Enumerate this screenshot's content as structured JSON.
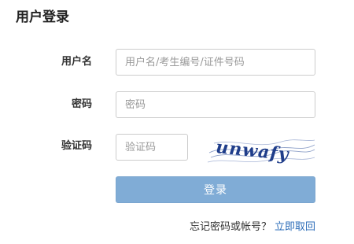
{
  "page": {
    "title": "用户登录"
  },
  "form": {
    "username": {
      "label": "用户名",
      "placeholder": "用户名/考生编号/证件号码",
      "value": ""
    },
    "password": {
      "label": "密码",
      "placeholder": "密码",
      "value": ""
    },
    "captcha": {
      "label": "验证码",
      "placeholder": "验证码",
      "value": "",
      "image_text": "unwafy"
    },
    "submit_label": "登录"
  },
  "footer": {
    "forgot_text": "忘记密码或帐号？",
    "recover_link": "立即取回"
  },
  "colors": {
    "button_bg": "#80acd6",
    "link": "#2b6cb8",
    "captcha_ink": "#1f3d8a"
  }
}
